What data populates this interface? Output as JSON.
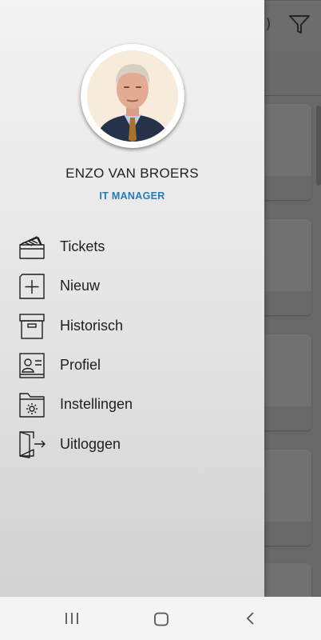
{
  "user": {
    "name": "ENZO VAN BROERS",
    "role": "IT MANAGER"
  },
  "menu": {
    "items": [
      {
        "label": "Tickets",
        "icon": "tickets-icon"
      },
      {
        "label": "Nieuw",
        "icon": "new-plus-icon"
      },
      {
        "label": "Historisch",
        "icon": "archive-box-icon"
      },
      {
        "label": "Profiel",
        "icon": "profile-card-icon"
      },
      {
        "label": "Instellingen",
        "icon": "settings-folder-icon"
      },
      {
        "label": "Uitloggen",
        "icon": "logout-door-icon"
      }
    ]
  },
  "system_nav": {
    "icons": [
      "recent-apps-icon",
      "home-icon",
      "back-icon"
    ]
  },
  "colors": {
    "role_accent": "#2a7ab0",
    "scrim": "rgba(0,0,0,0.55)"
  }
}
